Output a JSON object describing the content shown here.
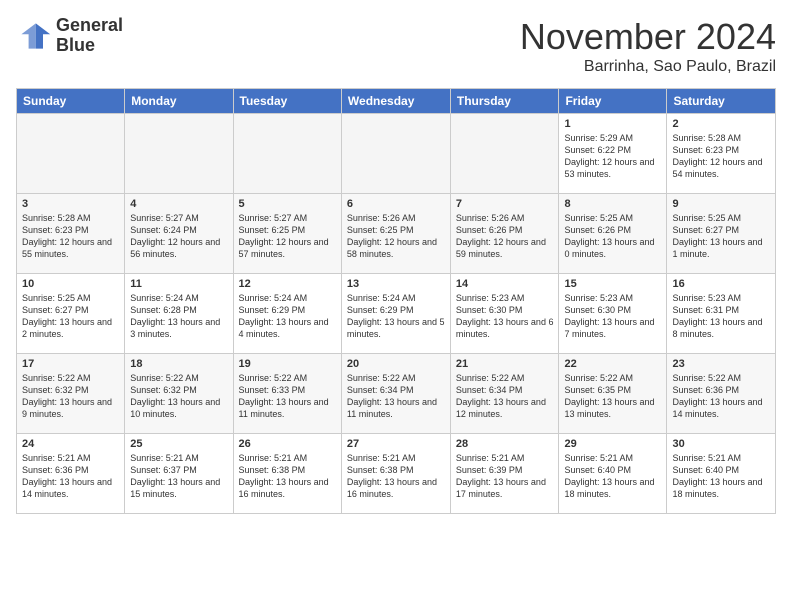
{
  "header": {
    "logo_line1": "General",
    "logo_line2": "Blue",
    "month": "November 2024",
    "location": "Barrinha, Sao Paulo, Brazil"
  },
  "weekdays": [
    "Sunday",
    "Monday",
    "Tuesday",
    "Wednesday",
    "Thursday",
    "Friday",
    "Saturday"
  ],
  "weeks": [
    [
      {
        "day": "",
        "empty": true
      },
      {
        "day": "",
        "empty": true
      },
      {
        "day": "",
        "empty": true
      },
      {
        "day": "",
        "empty": true
      },
      {
        "day": "",
        "empty": true
      },
      {
        "day": "1",
        "sunrise": "5:29 AM",
        "sunset": "6:22 PM",
        "daylight": "12 hours and 53 minutes."
      },
      {
        "day": "2",
        "sunrise": "5:28 AM",
        "sunset": "6:23 PM",
        "daylight": "12 hours and 54 minutes."
      }
    ],
    [
      {
        "day": "3",
        "sunrise": "5:28 AM",
        "sunset": "6:23 PM",
        "daylight": "12 hours and 55 minutes."
      },
      {
        "day": "4",
        "sunrise": "5:27 AM",
        "sunset": "6:24 PM",
        "daylight": "12 hours and 56 minutes."
      },
      {
        "day": "5",
        "sunrise": "5:27 AM",
        "sunset": "6:25 PM",
        "daylight": "12 hours and 57 minutes."
      },
      {
        "day": "6",
        "sunrise": "5:26 AM",
        "sunset": "6:25 PM",
        "daylight": "12 hours and 58 minutes."
      },
      {
        "day": "7",
        "sunrise": "5:26 AM",
        "sunset": "6:26 PM",
        "daylight": "12 hours and 59 minutes."
      },
      {
        "day": "8",
        "sunrise": "5:25 AM",
        "sunset": "6:26 PM",
        "daylight": "13 hours and 0 minutes."
      },
      {
        "day": "9",
        "sunrise": "5:25 AM",
        "sunset": "6:27 PM",
        "daylight": "13 hours and 1 minute."
      }
    ],
    [
      {
        "day": "10",
        "sunrise": "5:25 AM",
        "sunset": "6:27 PM",
        "daylight": "13 hours and 2 minutes."
      },
      {
        "day": "11",
        "sunrise": "5:24 AM",
        "sunset": "6:28 PM",
        "daylight": "13 hours and 3 minutes."
      },
      {
        "day": "12",
        "sunrise": "5:24 AM",
        "sunset": "6:29 PM",
        "daylight": "13 hours and 4 minutes."
      },
      {
        "day": "13",
        "sunrise": "5:24 AM",
        "sunset": "6:29 PM",
        "daylight": "13 hours and 5 minutes."
      },
      {
        "day": "14",
        "sunrise": "5:23 AM",
        "sunset": "6:30 PM",
        "daylight": "13 hours and 6 minutes."
      },
      {
        "day": "15",
        "sunrise": "5:23 AM",
        "sunset": "6:30 PM",
        "daylight": "13 hours and 7 minutes."
      },
      {
        "day": "16",
        "sunrise": "5:23 AM",
        "sunset": "6:31 PM",
        "daylight": "13 hours and 8 minutes."
      }
    ],
    [
      {
        "day": "17",
        "sunrise": "5:22 AM",
        "sunset": "6:32 PM",
        "daylight": "13 hours and 9 minutes."
      },
      {
        "day": "18",
        "sunrise": "5:22 AM",
        "sunset": "6:32 PM",
        "daylight": "13 hours and 10 minutes."
      },
      {
        "day": "19",
        "sunrise": "5:22 AM",
        "sunset": "6:33 PM",
        "daylight": "13 hours and 11 minutes."
      },
      {
        "day": "20",
        "sunrise": "5:22 AM",
        "sunset": "6:34 PM",
        "daylight": "13 hours and 11 minutes."
      },
      {
        "day": "21",
        "sunrise": "5:22 AM",
        "sunset": "6:34 PM",
        "daylight": "13 hours and 12 minutes."
      },
      {
        "day": "22",
        "sunrise": "5:22 AM",
        "sunset": "6:35 PM",
        "daylight": "13 hours and 13 minutes."
      },
      {
        "day": "23",
        "sunrise": "5:22 AM",
        "sunset": "6:36 PM",
        "daylight": "13 hours and 14 minutes."
      }
    ],
    [
      {
        "day": "24",
        "sunrise": "5:21 AM",
        "sunset": "6:36 PM",
        "daylight": "13 hours and 14 minutes."
      },
      {
        "day": "25",
        "sunrise": "5:21 AM",
        "sunset": "6:37 PM",
        "daylight": "13 hours and 15 minutes."
      },
      {
        "day": "26",
        "sunrise": "5:21 AM",
        "sunset": "6:38 PM",
        "daylight": "13 hours and 16 minutes."
      },
      {
        "day": "27",
        "sunrise": "5:21 AM",
        "sunset": "6:38 PM",
        "daylight": "13 hours and 16 minutes."
      },
      {
        "day": "28",
        "sunrise": "5:21 AM",
        "sunset": "6:39 PM",
        "daylight": "13 hours and 17 minutes."
      },
      {
        "day": "29",
        "sunrise": "5:21 AM",
        "sunset": "6:40 PM",
        "daylight": "13 hours and 18 minutes."
      },
      {
        "day": "30",
        "sunrise": "5:21 AM",
        "sunset": "6:40 PM",
        "daylight": "13 hours and 18 minutes."
      }
    ]
  ]
}
